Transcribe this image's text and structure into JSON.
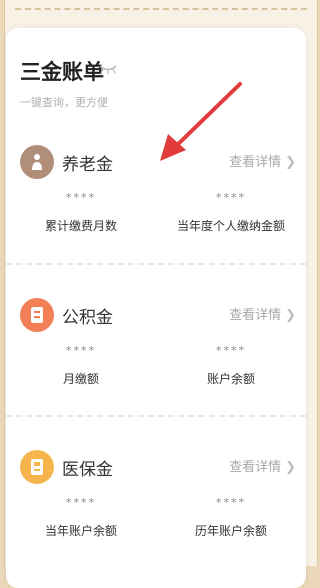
{
  "header": {
    "title": "三金账单",
    "subtitle": "一键查询，更方便"
  },
  "sections": [
    {
      "name": "养老金",
      "detail": "查看详情",
      "icon_color": "#b08e7a",
      "metrics": [
        {
          "value": "****",
          "label": "累计缴费月数"
        },
        {
          "value": "****",
          "label": "当年度个人缴纳金额"
        }
      ]
    },
    {
      "name": "公积金",
      "detail": "查看详情",
      "icon_color": "#f27f55",
      "metrics": [
        {
          "value": "****",
          "label": "月缴额"
        },
        {
          "value": "****",
          "label": "账户余额"
        }
      ]
    },
    {
      "name": "医保金",
      "detail": "查看详情",
      "icon_color": "#f6b44d",
      "metrics": [
        {
          "value": "****",
          "label": "当年账户余额"
        },
        {
          "value": "****",
          "label": "历年账户余额"
        }
      ]
    }
  ],
  "annotation_arrow_color": "#e23b3b"
}
